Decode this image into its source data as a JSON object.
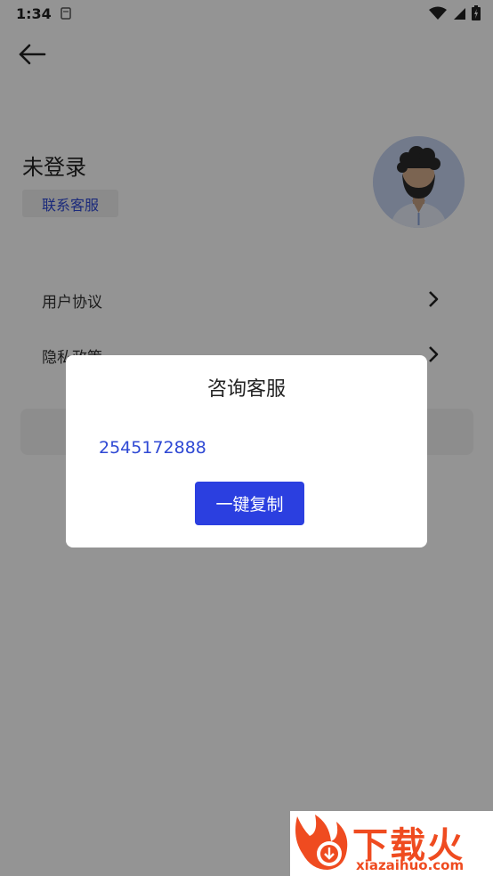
{
  "status_bar": {
    "time": "1:34"
  },
  "profile": {
    "name": "未登录",
    "contact_label": "联系客服"
  },
  "menu": [
    {
      "label": "用户协议"
    },
    {
      "label": "隐私政策"
    }
  ],
  "dialog": {
    "title": "咨询客服",
    "number": "2545172888",
    "copy_label": "一键复制"
  },
  "watermark": {
    "text": "下载火",
    "url": "xiazaihuo.com"
  },
  "colors": {
    "accent": "#2b3fe0",
    "link": "#2f49d4",
    "overlay": "rgba(0,0,0,0.42)",
    "watermark": "#ef4b20"
  }
}
